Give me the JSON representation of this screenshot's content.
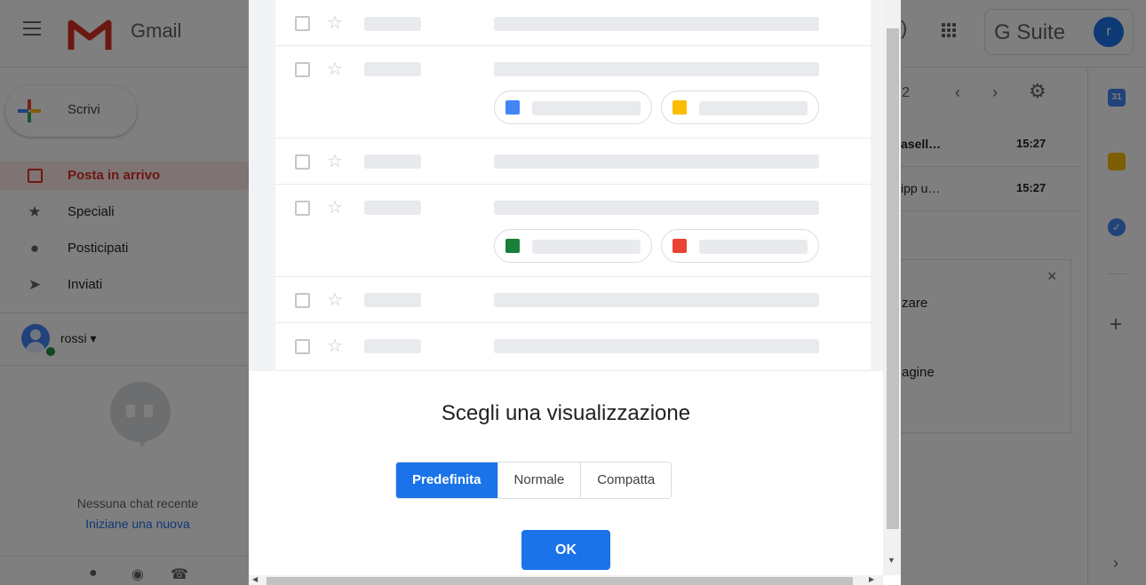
{
  "app": {
    "name": "Gmail",
    "gsuite_label": "G Suite",
    "avatar_letter": "r",
    "pager_text": "2"
  },
  "compose": {
    "label": "Scrivi"
  },
  "nav": {
    "items": [
      {
        "label": "Posta in arrivo",
        "icon": "inbox-icon",
        "active": true
      },
      {
        "label": "Speciali",
        "icon": "star-icon"
      },
      {
        "label": "Posticipati",
        "icon": "clock-icon"
      },
      {
        "label": "Inviati",
        "icon": "send-icon"
      }
    ]
  },
  "hangouts": {
    "user_name": "rossi",
    "no_chat": "Nessuna chat recente",
    "start_new": "Iniziane una nuova"
  },
  "mail_list": {
    "rows": [
      {
        "sender": "asell…",
        "time": "15:27"
      },
      {
        "sender": "ipp u…",
        "time": "15:27"
      }
    ]
  },
  "promo": {
    "line1": "zare",
    "line2": "agine"
  },
  "side_panel": {
    "calendar_day": "31"
  },
  "dialog": {
    "title": "Scegli una visualizzazione",
    "options": [
      "Predefinita",
      "Normale",
      "Compatta"
    ],
    "selected": "Predefinita",
    "ok_label": "OK"
  },
  "colors": {
    "accent": "#1a73e8",
    "inbox_red": "#d93025",
    "docs_blue": "#4285f4",
    "slides_yellow": "#fbbc04",
    "sheets_green": "#188038",
    "photo_red": "#ea4335"
  }
}
